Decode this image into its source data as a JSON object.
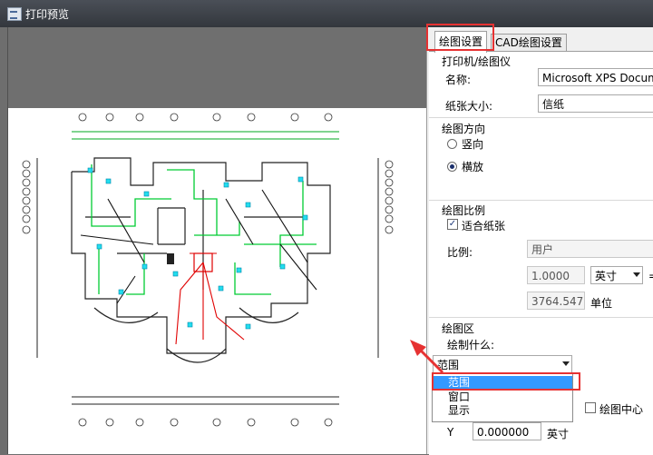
{
  "window": {
    "title": "打印预览"
  },
  "tabs": [
    {
      "label": "绘图设置",
      "active": true
    },
    {
      "label": "CAD绘图设置",
      "active": false
    }
  ],
  "printer_group": {
    "title": "打印机/绘图仪",
    "name_label": "名称:",
    "name_value": "Microsoft XPS Document",
    "paper_label": "纸张大小:",
    "paper_value": "信纸"
  },
  "orientation_group": {
    "title": "绘图方向",
    "portrait_label": "竖向",
    "landscape_label": "横放",
    "selected": "landscape"
  },
  "scale_group": {
    "title": "绘图比例",
    "fit_label": "适合纸张",
    "fit_checked": true,
    "scale_label": "比例:",
    "scale_value": "用户",
    "ratio_value": "1.0000",
    "unit_value": "英寸",
    "equals": "=",
    "units_value": "3764.5470",
    "units_label": "单位"
  },
  "area_group": {
    "title": "绘图区",
    "what_label": "绘制什么:",
    "current": "范围",
    "options": [
      "范围",
      "窗口",
      "显示"
    ],
    "selected_option": "范围",
    "center_label": "绘图中心",
    "center_checked": false,
    "y_label": "Y",
    "y_value": "0.000000",
    "y_unit": "英寸"
  },
  "colors": {
    "highlight": "#e63232",
    "selection": "#3399ff",
    "drawing_green": "#00cc33",
    "drawing_red": "#e00000"
  },
  "icons": {
    "app": "print-preview-icon",
    "dropdown": "chevron-down-icon"
  }
}
